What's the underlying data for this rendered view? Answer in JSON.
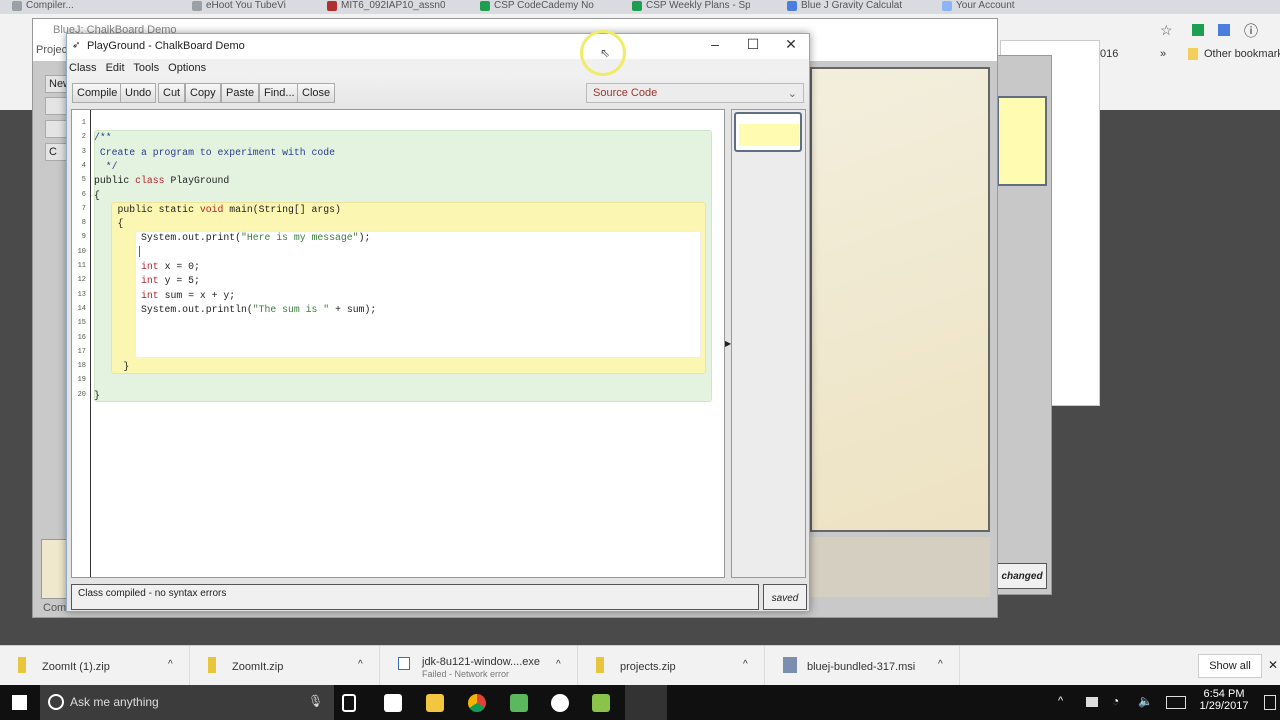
{
  "browser": {
    "tabs": [
      "Compiler...",
      "eHoot You TubeVi",
      "MIT6_092IAP10_assn0",
      "CSP CodeCademy No",
      "CSP Weekly Plans - Sp",
      "Blue J Gravity Calculat",
      "Your Account"
    ],
    "tab_colors": [
      "#9aa0a6",
      "#9aa0a6",
      "#b03030",
      "#1e9e50",
      "#1e9e50",
      "#4a7fe0",
      "#8ab4f8"
    ],
    "partial_text": "016",
    "bookmark": "Other bookmarks"
  },
  "bluej_main": {
    "title": "BlueJ: ChalkBoard Demo",
    "menu_partial": "Project",
    "side_buttons": [
      "New",
      "",
      "",
      "C"
    ],
    "status_partial": "Com"
  },
  "back_editor": {
    "status_label": "changed"
  },
  "editor": {
    "title": "PlayGround - ChalkBoard Demo",
    "menu": [
      "Class",
      "Edit",
      "Tools",
      "Options"
    ],
    "toolbar": [
      "Compile",
      "Undo",
      "Cut",
      "Copy",
      "Paste",
      "Find...",
      "Close"
    ],
    "view_select": "Source Code",
    "code": [
      [],
      [
        [
          "/**",
          "c"
        ]
      ],
      [
        [
          " Create a program to experiment with code",
          "c"
        ]
      ],
      [
        [
          "  */",
          "c"
        ]
      ],
      [
        [
          "public ",
          "p"
        ],
        [
          "class ",
          "k"
        ],
        [
          "PlayGround",
          "p"
        ]
      ],
      [
        [
          "{",
          "p"
        ]
      ],
      [
        [
          "    public static ",
          "p"
        ],
        [
          "void ",
          "k"
        ],
        [
          "main(String[] args)",
          "p"
        ]
      ],
      [
        [
          "    {",
          "p"
        ]
      ],
      [
        [
          "        System.out.print(",
          "p"
        ],
        [
          "\"Here is my message\"",
          "s"
        ],
        [
          ");",
          "p"
        ]
      ],
      [],
      [
        [
          "        ",
          "p"
        ],
        [
          "int ",
          "k"
        ],
        [
          "x = 0;",
          "p"
        ]
      ],
      [
        [
          "        ",
          "p"
        ],
        [
          "int ",
          "k"
        ],
        [
          "y = 5;",
          "p"
        ]
      ],
      [
        [
          "        ",
          "p"
        ],
        [
          "int ",
          "k"
        ],
        [
          "sum = x + y;",
          "p"
        ]
      ],
      [
        [
          "        System.out.println(",
          "p"
        ],
        [
          "\"The sum is \"",
          "s"
        ],
        [
          " + sum);",
          "p"
        ]
      ],
      [],
      [],
      [],
      [
        [
          "     }",
          "p"
        ]
      ],
      [],
      [
        [
          "}",
          "p"
        ]
      ]
    ],
    "status_message": "Class compiled - no syntax errors",
    "saved_label": "saved"
  },
  "downloads": [
    {
      "name": "ZoomIt (1).zip",
      "sub": ""
    },
    {
      "name": "ZoomIt.zip",
      "sub": ""
    },
    {
      "name": "jdk-8u121-window....exe",
      "sub": "Failed - Network error"
    },
    {
      "name": "projects.zip",
      "sub": ""
    },
    {
      "name": "bluej-bundled-317.msi",
      "sub": ""
    }
  ],
  "show_all": "Show all",
  "taskbar": {
    "search_placeholder": "Ask me anything",
    "time": "6:54 PM",
    "date": "1/29/2017"
  }
}
